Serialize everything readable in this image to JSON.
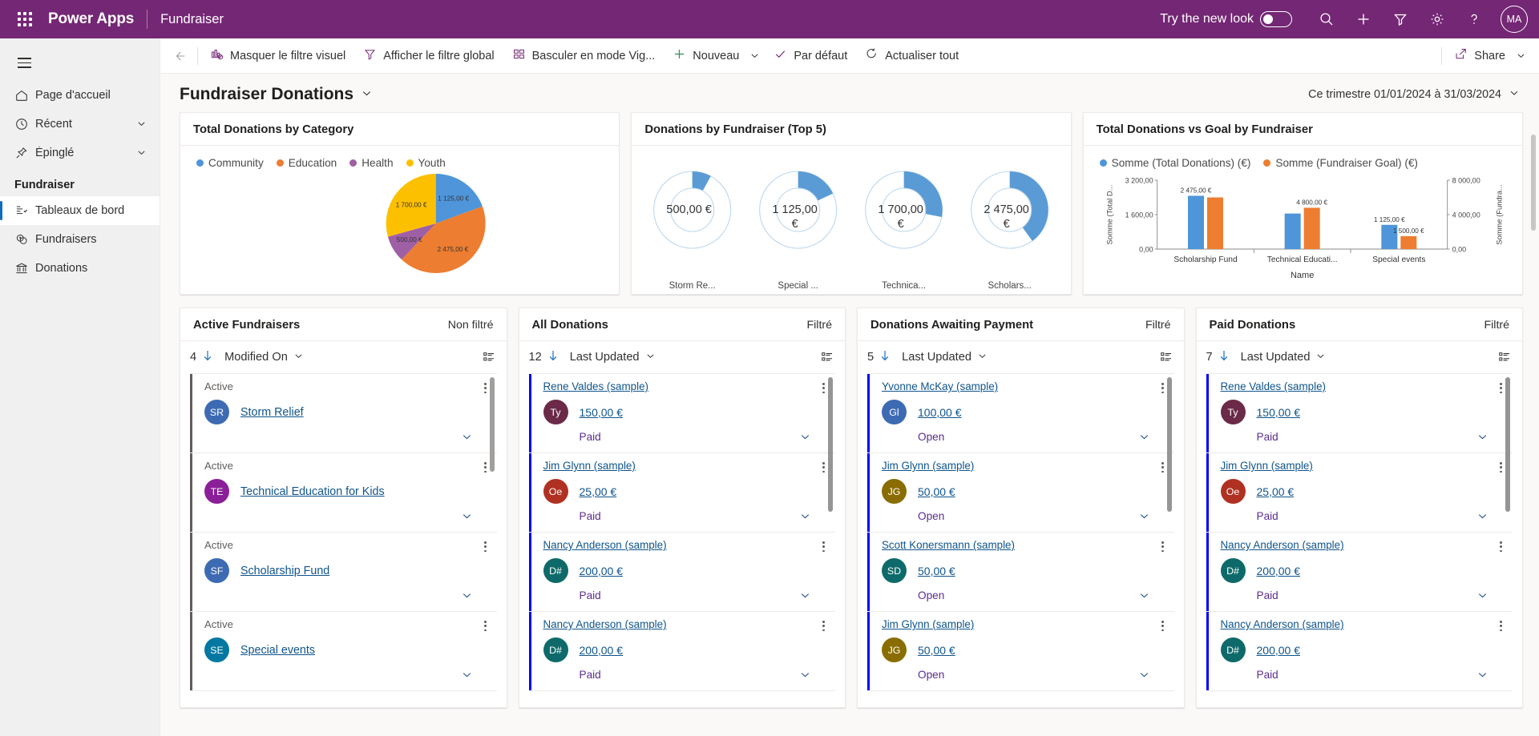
{
  "topbar": {
    "waffle_name": "app-launcher",
    "brand": "Power Apps",
    "app_name": "Fundraiser",
    "try_new_look": "Try the new look",
    "avatar_initials": "MA",
    "purple": "#742774"
  },
  "sidebar": {
    "items": [
      {
        "label": "Page d'accueil",
        "icon": "home-icon",
        "chevron": false
      },
      {
        "label": "Récent",
        "icon": "clock-icon",
        "chevron": true
      },
      {
        "label": "Épinglé",
        "icon": "pin-icon",
        "chevron": true
      }
    ],
    "group_title": "Fundraiser",
    "group_items": [
      {
        "label": "Tableaux de bord",
        "icon": "dashboard-icon",
        "selected": true
      },
      {
        "label": "Fundraisers",
        "icon": "fundraiser-icon",
        "selected": false
      },
      {
        "label": "Donations",
        "icon": "bank-icon",
        "selected": false
      }
    ]
  },
  "commandbar": {
    "items": [
      {
        "label": "Masquer le filtre visuel",
        "icon": "hide-visual-filter-icon",
        "caret": false
      },
      {
        "label": "Afficher le filtre global",
        "icon": "funnel-icon",
        "caret": false
      },
      {
        "label": "Basculer en mode Vig...",
        "icon": "tiles-icon",
        "caret": false
      },
      {
        "label": "Nouveau",
        "icon": "plus-icon",
        "caret": true
      },
      {
        "label": "Par défaut",
        "icon": "check-icon",
        "caret": false
      },
      {
        "label": "Actualiser tout",
        "icon": "refresh-icon",
        "caret": false
      }
    ],
    "share_label": "Share"
  },
  "page": {
    "title": "Fundraiser Donations",
    "date_range": "Ce trimestre 01/01/2024 à 31/03/2024"
  },
  "chart_data": [
    {
      "type": "pie",
      "title": "Total Donations by Category",
      "categories": [
        "Community",
        "Education",
        "Health",
        "Youth"
      ],
      "values": [
        1125,
        2475,
        500,
        1700
      ],
      "labels": [
        "1 125,00 €",
        "2 475,00 €",
        "500,00 €",
        "1 700,00 €"
      ],
      "colors": [
        "#4e95d9",
        "#ed7d31",
        "#9e5fa5",
        "#fdc000"
      ],
      "legend_position": "top"
    },
    {
      "type": "pie",
      "subtype": "donut-grid",
      "title": "Donations by Fundraiser (Top 5)",
      "categories": [
        "Storm Re...",
        "Special ...",
        "Technica...",
        "Scholars..."
      ],
      "values": [
        500,
        1125,
        1700,
        2475
      ],
      "labels": [
        "500,00 €",
        "1 125,00 €",
        "1 700,00 €",
        "2 475,00 €"
      ],
      "percents": [
        8,
        18,
        28,
        40
      ],
      "color": "#5b9bd5",
      "track_color": "#ffffff"
    },
    {
      "type": "bar",
      "title": "Total Donations vs Goal by Fundraiser",
      "categories": [
        "Scholarship Fund",
        "Technical Educati...",
        "Special events"
      ],
      "series": [
        {
          "name": "Somme (Total Donations) (€)",
          "values": [
            2475,
            1650,
            1125
          ],
          "color": "#4e95d9",
          "axis": "left",
          "labels": [
            "2 475,00 €",
            "",
            "1 125,00 €"
          ]
        },
        {
          "name": "Somme (Fundraiser Goal) (€)",
          "values": [
            6000,
            4800,
            1500
          ],
          "color": "#ed7d31",
          "axis": "right",
          "labels": [
            "",
            "4 800,00 €",
            "1 500,00 €"
          ]
        }
      ],
      "xlabel": "Name",
      "ylabel_left": "Somme (Total D...",
      "ylabel_right": "Somme (Fundra...",
      "ylim_left": [
        0,
        3200
      ],
      "yticks_left": [
        "0,00",
        "1 600,00",
        "3 200,00"
      ],
      "ylim_right": [
        0,
        8000
      ],
      "yticks_right": [
        "0,00",
        "4 000,00",
        "8 000,00"
      ],
      "grid": false,
      "legend_position": "top"
    }
  ],
  "lists": [
    {
      "title": "Active Fundraisers",
      "filter_state": "Non filtré",
      "count": "4",
      "sort": "Modified On",
      "accent": "#605e5c",
      "scrollbar_color": "#a19f9d",
      "rows": [
        {
          "status_label": "Active",
          "initials": "SR",
          "avatar_color": "#3d6bb3",
          "name": "Storm Relief"
        },
        {
          "status_label": "Active",
          "initials": "TE",
          "avatar_color": "#8b1f99",
          "name": "Technical Education for Kids"
        },
        {
          "status_label": "Active",
          "initials": "SF",
          "avatar_color": "#3d6bb3",
          "name": "Scholarship Fund"
        },
        {
          "status_label": "Active",
          "initials": "SE",
          "avatar_color": "#0078a1",
          "name": "Special events"
        }
      ]
    },
    {
      "title": "All Donations",
      "filter_state": "Filtré",
      "count": "12",
      "sort": "Last Updated",
      "accent": "#0000ff",
      "scrollbar_color": "#979593",
      "rows": [
        {
          "primary": "Rene Valdes (sample)",
          "initials": "Ty",
          "avatar_color": "#6b2a48",
          "amount": "150,00 €",
          "state": "Paid"
        },
        {
          "primary": "Jim Glynn (sample)",
          "initials": "Oe",
          "avatar_color": "#b03122",
          "amount": "25,00 €",
          "state": "Paid"
        },
        {
          "primary": "Nancy Anderson (sample)",
          "initials": "D#",
          "avatar_color": "#0e6a6a",
          "amount": "200,00 €",
          "state": "Paid"
        },
        {
          "primary": "Nancy Anderson (sample)",
          "initials": "D#",
          "avatar_color": "#0e6a6a",
          "amount": "200,00 €",
          "state": "Paid"
        }
      ]
    },
    {
      "title": "Donations Awaiting Payment",
      "filter_state": "Filtré",
      "count": "5",
      "sort": "Last Updated",
      "accent": "#0000ff",
      "scrollbar_color": "#979593",
      "rows": [
        {
          "primary": "Yvonne McKay (sample)",
          "initials": "Gl",
          "avatar_color": "#3d6bb3",
          "amount": "100,00 €",
          "state": "Open"
        },
        {
          "primary": "Jim Glynn (sample)",
          "initials": "JG",
          "avatar_color": "#8a6d00",
          "amount": "50,00 €",
          "state": "Open"
        },
        {
          "primary": "Scott Konersmann (sample)",
          "initials": "SD",
          "avatar_color": "#0e6a6a",
          "amount": "50,00 €",
          "state": "Open"
        },
        {
          "primary": "Jim Glynn (sample)",
          "initials": "JG",
          "avatar_color": "#8a6d00",
          "amount": "50,00 €",
          "state": "Open"
        }
      ]
    },
    {
      "title": "Paid Donations",
      "filter_state": "Filtré",
      "count": "7",
      "sort": "Last Updated",
      "accent": "#0000ff",
      "scrollbar_color": "#979593",
      "rows": [
        {
          "primary": "Rene Valdes (sample)",
          "initials": "Ty",
          "avatar_color": "#6b2a48",
          "amount": "150,00 €",
          "state": "Paid"
        },
        {
          "primary": "Jim Glynn (sample)",
          "initials": "Oe",
          "avatar_color": "#b03122",
          "amount": "25,00 €",
          "state": "Paid"
        },
        {
          "primary": "Nancy Anderson (sample)",
          "initials": "D#",
          "avatar_color": "#0e6a6a",
          "amount": "200,00 €",
          "state": "Paid"
        },
        {
          "primary": "Nancy Anderson (sample)",
          "initials": "D#",
          "avatar_color": "#0e6a6a",
          "amount": "200,00 €",
          "state": "Paid"
        }
      ]
    }
  ]
}
